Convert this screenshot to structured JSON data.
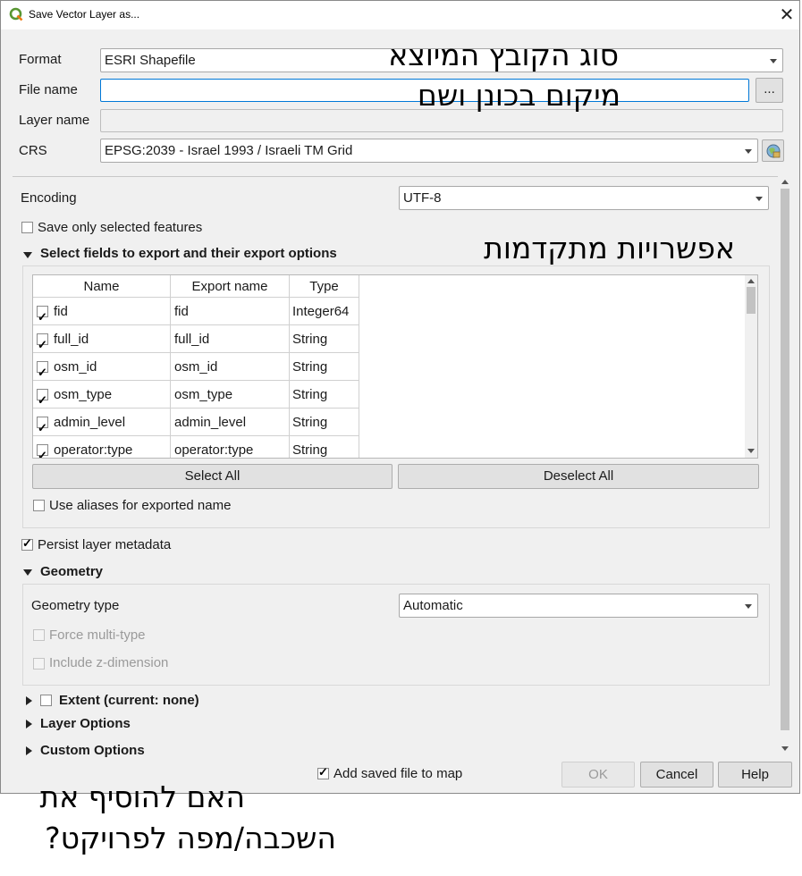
{
  "window": {
    "title": "Save Vector Layer as...",
    "close_glyph": "✕"
  },
  "format": {
    "label": "Format",
    "value": "ESRI Shapefile"
  },
  "file_name": {
    "label": "File name",
    "value": "",
    "browse_label": "..."
  },
  "layer_name": {
    "label": "Layer name",
    "value": ""
  },
  "crs": {
    "label": "CRS",
    "value": "EPSG:2039 - Israel 1993 / Israeli TM Grid"
  },
  "encoding": {
    "label": "Encoding",
    "value": "UTF-8"
  },
  "save_selected": {
    "label": "Save only selected features",
    "checked": false
  },
  "fields_section": {
    "title": "Select fields to export and their export options",
    "columns": [
      "Name",
      "Export name",
      "Type"
    ],
    "rows": [
      {
        "checked": true,
        "name": "fid",
        "export_name": "fid",
        "type": "Integer64"
      },
      {
        "checked": true,
        "name": "full_id",
        "export_name": "full_id",
        "type": "String"
      },
      {
        "checked": true,
        "name": "osm_id",
        "export_name": "osm_id",
        "type": "String"
      },
      {
        "checked": true,
        "name": "osm_type",
        "export_name": "osm_type",
        "type": "String"
      },
      {
        "checked": true,
        "name": "admin_level",
        "export_name": "admin_level",
        "type": "String"
      },
      {
        "checked": true,
        "name": "operator:type",
        "export_name": "operator:type",
        "type": "String"
      }
    ],
    "select_all": "Select All",
    "deselect_all": "Deselect All",
    "use_aliases": "Use aliases for exported name"
  },
  "persist_metadata": {
    "label": "Persist layer metadata",
    "checked": true
  },
  "geometry": {
    "title": "Geometry",
    "type_label": "Geometry type",
    "type_value": "Automatic",
    "force_multi": "Force multi-type",
    "include_z": "Include z-dimension"
  },
  "extent": {
    "label": "Extent (current: none)"
  },
  "layer_options": {
    "label": "Layer Options"
  },
  "custom_options": {
    "label": "Custom Options"
  },
  "footer": {
    "add_to_map": "Add saved file to map",
    "ok": "OK",
    "cancel": "Cancel",
    "help": "Help"
  },
  "annotations": {
    "format_note": "סוג הקובץ המיוצא",
    "filename_note": "מיקום בכונן ושם",
    "advanced_note": "אפשרויות מתקדמות",
    "add_map_note_line1": "האם להוסיף את",
    "add_map_note_line2": "השכבה/מפה לפרויקט?"
  },
  "colors": {
    "accent": "#0078d7",
    "dialog_bg": "#f0f0f0",
    "qgis_green": "#589632"
  }
}
